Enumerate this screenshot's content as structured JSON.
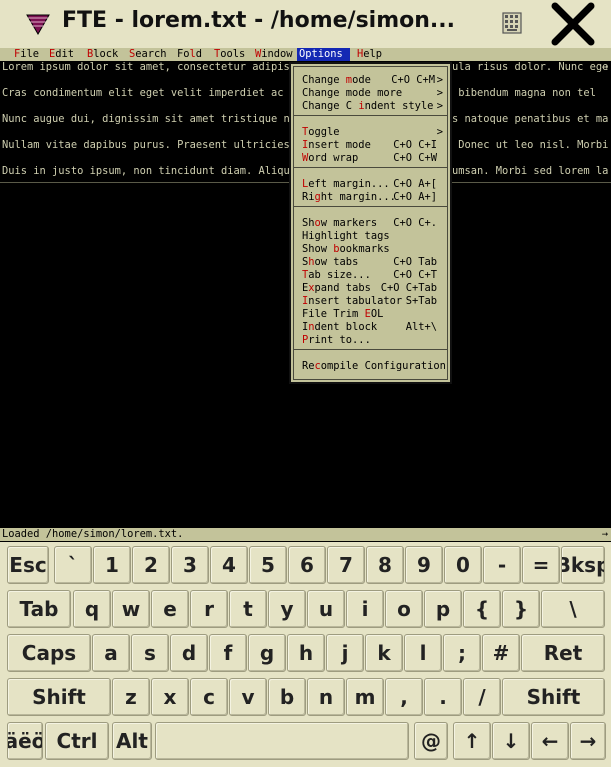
{
  "titlebar": {
    "title": "FTE - lorem.txt - /home/simon...",
    "app_icon": "fte-app-icon",
    "keyboard_icon": "keyboard-icon",
    "close_icon": "close-icon"
  },
  "menubar": {
    "items": [
      {
        "hotkey": "F",
        "rest": "ile",
        "active": false
      },
      {
        "hotkey": "E",
        "rest": "dit",
        "active": false
      },
      {
        "hotkey": "B",
        "rest": "lock",
        "active": false
      },
      {
        "hotkey": "S",
        "rest": "earch",
        "active": false
      },
      {
        "pre": "Fo",
        "hotkey": "l",
        "rest": "d",
        "active": false
      },
      {
        "hotkey": "T",
        "rest": "ools",
        "active": false
      },
      {
        "hotkey": "W",
        "rest": "indow",
        "active": false
      },
      {
        "hotkey": "O",
        "rest": "ptions",
        "active": true
      },
      {
        "hotkey": "H",
        "rest": "elp",
        "active": false
      }
    ]
  },
  "editor": {
    "lines": [
      {
        "left": "Lorem ipsum dolor sit amet, consectetur adipisci",
        "right": "ula risus dolor. Nunc ege",
        "marker": "→"
      },
      {
        "left": "",
        "right": "",
        "marker": ""
      },
      {
        "left": "Cras condimentum elit eget velit imperdiet ac co",
        "right": " bibendum magna non tel",
        "marker": ""
      },
      {
        "left": "",
        "right": "",
        "marker": ""
      },
      {
        "left": "Nunc augue dui, dignissim sit amet tristique nec",
        "right": "s natoque penatibus et ma",
        "marker": ""
      },
      {
        "left": "",
        "right": "",
        "marker": ""
      },
      {
        "left": "Nullam vitae dapibus purus. Praesent ultricies f",
        "right": " Donec ut leo nisl. Morbi",
        "marker": ""
      },
      {
        "left": "",
        "right": "",
        "marker": ""
      },
      {
        "left": "Duis in justo ipsum, non tincidunt diam. Aliquam",
        "right": "umsan. Morbi sed lorem la",
        "marker": ""
      }
    ],
    "status": "Loaded /home/simon/lorem.txt."
  },
  "options_menu": {
    "groups": [
      [
        {
          "pre": "Change ",
          "hotkey": "m",
          "rest": "ode",
          "key": "C+O C+M",
          "submenu": true
        },
        {
          "pre": "Change mode more",
          "hotkey": "",
          "rest": "",
          "key": "",
          "submenu": true
        },
        {
          "pre": "Change C ",
          "hotkey": "i",
          "rest": "ndent style",
          "key": "",
          "submenu": true
        }
      ],
      [
        {
          "pre": "",
          "hotkey": "T",
          "rest": "oggle",
          "key": "",
          "submenu": true
        },
        {
          "pre": "",
          "hotkey": "I",
          "rest": "nsert mode",
          "key": "C+O C+I",
          "submenu": false
        },
        {
          "pre": "",
          "hotkey": "W",
          "rest": "ord wrap",
          "key": "C+O C+W",
          "submenu": false
        }
      ],
      [
        {
          "pre": "",
          "hotkey": "L",
          "rest": "eft margin...",
          "key": "C+O A+[",
          "submenu": false
        },
        {
          "pre": "Ri",
          "hotkey": "g",
          "rest": "ht margin...",
          "key": "C+O A+]",
          "submenu": false
        }
      ],
      [
        {
          "pre": "Sh",
          "hotkey": "o",
          "rest": "w markers",
          "key": "C+O C+.",
          "submenu": false
        },
        {
          "pre": "Highlight tags",
          "hotkey": "",
          "rest": "",
          "key": "",
          "submenu": false
        },
        {
          "pre": "Show ",
          "hotkey": "b",
          "rest": "ookmarks",
          "key": "",
          "submenu": false
        },
        {
          "pre": "S",
          "hotkey": "h",
          "rest": "ow tabs",
          "key": "C+O Tab",
          "submenu": false
        },
        {
          "pre": "",
          "hotkey": "T",
          "rest": "ab size...",
          "key": "C+O C+T",
          "submenu": false
        },
        {
          "pre": "E",
          "hotkey": "x",
          "rest": "pand tabs",
          "key": "C+O C+Tab",
          "submenu": false
        },
        {
          "pre": "",
          "hotkey": "I",
          "rest": "nsert tabulator",
          "key": "S+Tab",
          "submenu": false
        },
        {
          "pre": "File Trim ",
          "hotkey": "E",
          "rest": "OL",
          "key": "",
          "submenu": false
        },
        {
          "pre": "I",
          "hotkey": "n",
          "rest": "dent block",
          "key": "Alt+\\",
          "submenu": false
        },
        {
          "pre": "",
          "hotkey": "P",
          "rest": "rint to...",
          "key": "",
          "submenu": false
        }
      ],
      [
        {
          "pre": "Re",
          "hotkey": "c",
          "rest": "ompile Configuration",
          "key": "",
          "submenu": false
        }
      ]
    ]
  },
  "keyboard": {
    "rows": [
      [
        "Esc",
        "`",
        "1",
        "2",
        "3",
        "4",
        "5",
        "6",
        "7",
        "8",
        "9",
        "0",
        "-",
        "=",
        "Bksp"
      ],
      [
        "Tab",
        "q",
        "w",
        "e",
        "r",
        "t",
        "y",
        "u",
        "i",
        "o",
        "p",
        "{",
        "}",
        "\\"
      ],
      [
        "Caps",
        "a",
        "s",
        "d",
        "f",
        "g",
        "h",
        "j",
        "k",
        "l",
        ";",
        "#",
        "Ret"
      ],
      [
        "Shift",
        "z",
        "x",
        "c",
        "v",
        "b",
        "n",
        "m",
        ",",
        ".",
        "/",
        "Shift"
      ],
      [
        "äëö",
        "Ctrl",
        "Alt",
        "",
        "@",
        "↑",
        "↓",
        "←",
        "→"
      ]
    ]
  }
}
